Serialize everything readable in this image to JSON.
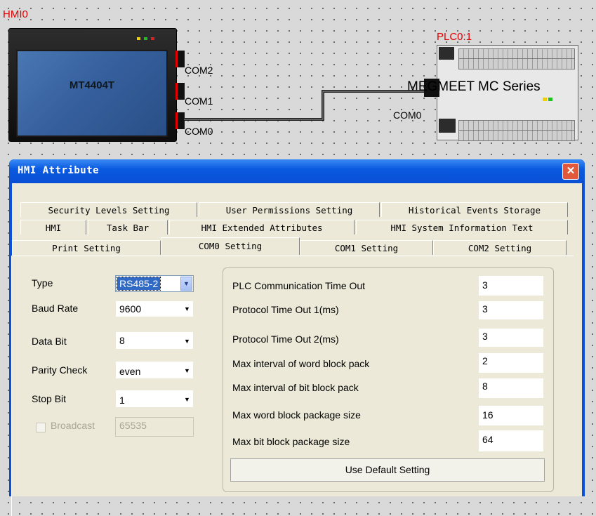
{
  "canvas": {
    "hmi_label": "HMI0",
    "plc_label": "PLC0:1",
    "hmi_model": "MT4404T",
    "ports": [
      "COM2",
      "COM1",
      "COM0"
    ],
    "plc_port": "COM0",
    "plc_name": "MEGMEET MC Series"
  },
  "dialog": {
    "title": "HMI Attribute",
    "close_symbol": "✕",
    "tabs_row1": [
      "Security Levels Setting",
      "User Permissions Setting",
      "Historical Events Storage"
    ],
    "tabs_row2": [
      "HMI",
      "Task Bar",
      "HMI Extended Attributes",
      "HMI System Information Text"
    ],
    "tabs_row3": [
      "Print Setting",
      "COM0 Setting",
      "COM1 Setting",
      "COM2 Setting"
    ],
    "active_tab": "COM0 Setting"
  },
  "form": {
    "type_label": "Type",
    "type_value": "RS485-2",
    "baud_label": "Baud Rate",
    "baud_value": "9600",
    "databit_label": "Data Bit",
    "databit_value": "8",
    "parity_label": "Parity Check",
    "parity_value": "even",
    "stopbit_label": "Stop Bit",
    "stopbit_value": "1",
    "broadcast_label": "Broadcast",
    "broadcast_value": "65535"
  },
  "timeouts": [
    {
      "label": "PLC Communication Time Out",
      "value": "3"
    },
    {
      "label": "Protocol Time Out 1(ms)",
      "value": "3"
    },
    {
      "label": "Protocol Time Out 2(ms)",
      "value": "3"
    },
    {
      "label": "Max interval of word block pack",
      "value": "2"
    },
    {
      "label": "Max interval of bit block pack",
      "value": "8"
    },
    {
      "label": "Max word block package size",
      "value": "16"
    },
    {
      "label": "Max bit block package size",
      "value": "64"
    }
  ],
  "default_button": "Use Default Setting",
  "colors": {
    "title_bar": "#0a5ae0",
    "close": "#e2583a",
    "label_red": "#e20000",
    "selection": "#316ac5"
  }
}
